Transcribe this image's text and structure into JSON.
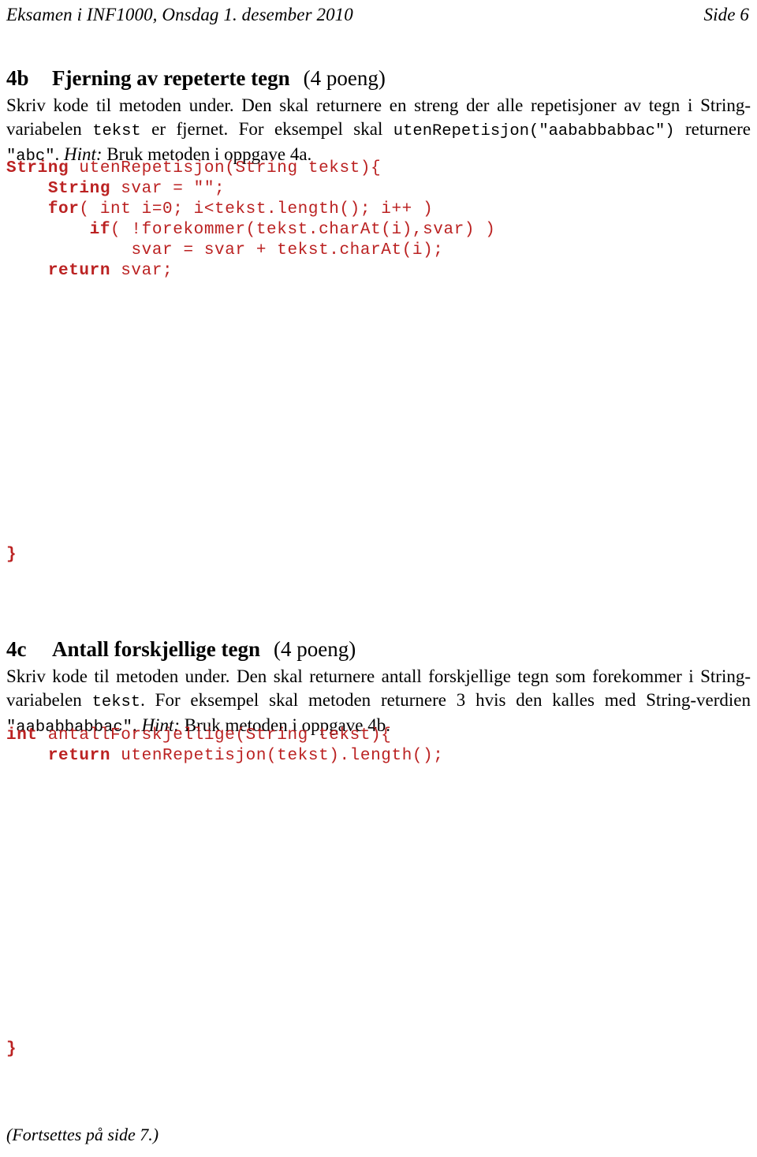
{
  "running_head": {
    "left": "Eksamen i INF1000, Onsdag 1. desember 2010",
    "right": "Side 6"
  },
  "sections": [
    {
      "number": "4b",
      "title": "Fjerning av repeterte tegn",
      "points": "(4 poeng)",
      "body": {
        "t1": "Skriv kode til metoden under. Den skal returnere en streng der alle repetisjoner av tegn i String-variabelen ",
        "code1": "tekst",
        "t2": " er fjernet. For eksempel skal ",
        "code2": "utenRepetisjon(\"aababbabbac\")",
        "t3": " returnere ",
        "code3": "\"abc\"",
        "t4": ". ",
        "hint": "Hint:",
        "t5": " Bruk metoden i oppgave 4a."
      },
      "code_lines": [
        {
          "kw": "String",
          "rest": " utenRepetisjon(String tekst){"
        },
        {
          "indent": "    ",
          "kw": "String",
          "rest": " svar = \"\";"
        },
        {
          "indent": "    ",
          "kw": "for",
          "rest": "( int i=0; i<tekst.length(); i++ )"
        },
        {
          "indent": "        ",
          "kw": "if",
          "rest": "( !forekommer(tekst.charAt(i),svar) )"
        },
        {
          "indent": "            ",
          "kw": "",
          "rest": "svar = svar + tekst.charAt(i);"
        },
        {
          "indent": "    ",
          "kw": "return",
          "rest": " svar;"
        }
      ],
      "closing_brace": "}"
    },
    {
      "number": "4c",
      "title": "Antall forskjellige tegn",
      "points": "(4 poeng)",
      "body": {
        "t1": "Skriv kode til metoden under. Den skal returnere antall forskjellige tegn som forekommer i String-variabelen ",
        "code1": "tekst",
        "t2": ". For eksempel skal metoden returnere 3 hvis den kalles med String-verdien ",
        "code2": "\"aababbabbac\"",
        "t3": ". ",
        "hint": "Hint:",
        "t4": " Bruk metoden i oppgave 4b."
      },
      "code_lines": [
        {
          "kw": "int",
          "rest": " antallForskjellige(String tekst){"
        },
        {
          "indent": "    ",
          "kw": "return",
          "rest": " utenRepetisjon(tekst).length();"
        }
      ],
      "closing_brace": "}"
    }
  ],
  "footer": "(Fortsettes på side 7.)",
  "colors": {
    "code_red": "#bb2222",
    "text_black": "#000000",
    "page_background": "#ffffff"
  }
}
